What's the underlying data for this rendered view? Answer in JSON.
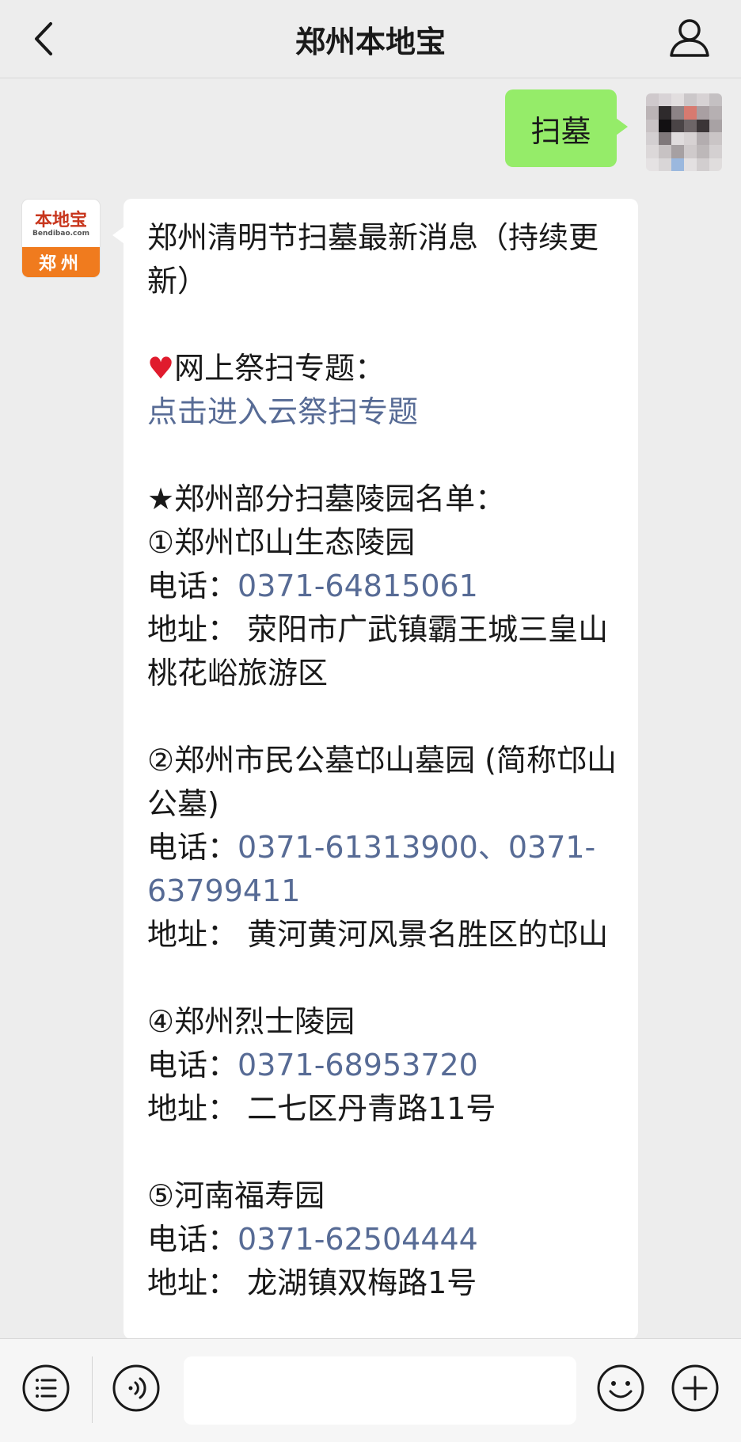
{
  "header": {
    "title": "郑州本地宝",
    "back_icon": "chevron-left-icon",
    "profile_icon": "person-icon"
  },
  "sent_message": {
    "text": "扫墓"
  },
  "bot_avatar": {
    "logo_text": "本地宝",
    "logo_sub": "Bendibao.com",
    "city": "郑州"
  },
  "reply": {
    "title": "郑州清明节扫墓最新消息（持续更新）",
    "online_heading": "网上祭扫专题：",
    "online_link": "点击进入云祭扫专题",
    "list_heading": "★郑州部分扫墓陵园名单：",
    "cemeteries": [
      {
        "name": "①郑州邙山生态陵园",
        "phone_label": "电话：",
        "phone": "0371-64815061",
        "address": "地址： 荥阳市广武镇霸王城三皇山桃花峪旅游区"
      },
      {
        "name": "②郑州市民公墓邙山墓园 (简称邙山公墓)",
        "phone_label": "电话：",
        "phone": "0371-61313900、0371-63799411",
        "address": "地址： 黄河黄河风景名胜区的邙山"
      },
      {
        "name": "④郑州烈士陵园",
        "phone_label": "电话：",
        "phone": "0371-68953720",
        "address": "地址： 二七区丹青路11号"
      },
      {
        "name": "⑤河南福寿园",
        "phone_label": "电话：",
        "phone": "0371-62504444",
        "address": "地址： 龙湖镇双梅路1号"
      }
    ]
  },
  "input_bar": {
    "menu_icon": "list-menu-icon",
    "voice_icon": "voice-icon",
    "input_value": "",
    "emoji_icon": "emoji-icon",
    "plus_icon": "plus-icon"
  },
  "colors": {
    "background": "#ededed",
    "sent_bubble": "#95ec69",
    "link": "#576b95",
    "brand_orange": "#f07b1e"
  }
}
